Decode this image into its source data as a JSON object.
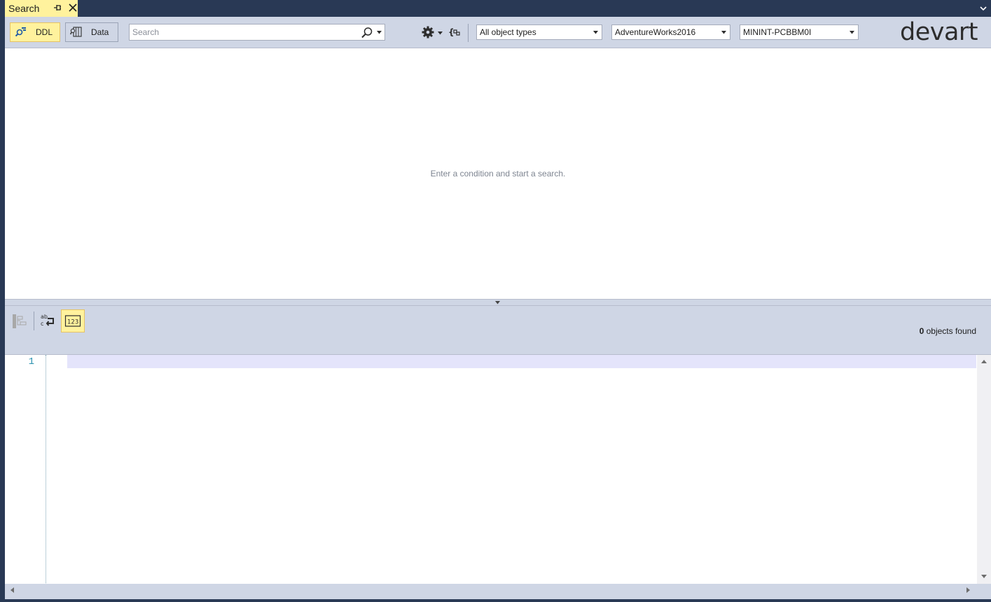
{
  "tab": {
    "title": "Search"
  },
  "toolbar": {
    "ddl_label": "DDL",
    "data_label": "Data",
    "search_placeholder": "Search",
    "search_value": "",
    "object_types": "All object types",
    "database": "AdventureWorks2016",
    "server": "MININT-PCBBM0I",
    "logo": "devart"
  },
  "results": {
    "empty_message": "Enter a condition and start a search."
  },
  "status": {
    "count": "0",
    "suffix": "objects found"
  },
  "editor": {
    "line_number": "1"
  },
  "colors": {
    "accent": "#fff29d",
    "frame": "#cfd6e5",
    "titlebar": "#293955",
    "line_number": "#2b91af",
    "current_line": "#e4e4fb"
  }
}
